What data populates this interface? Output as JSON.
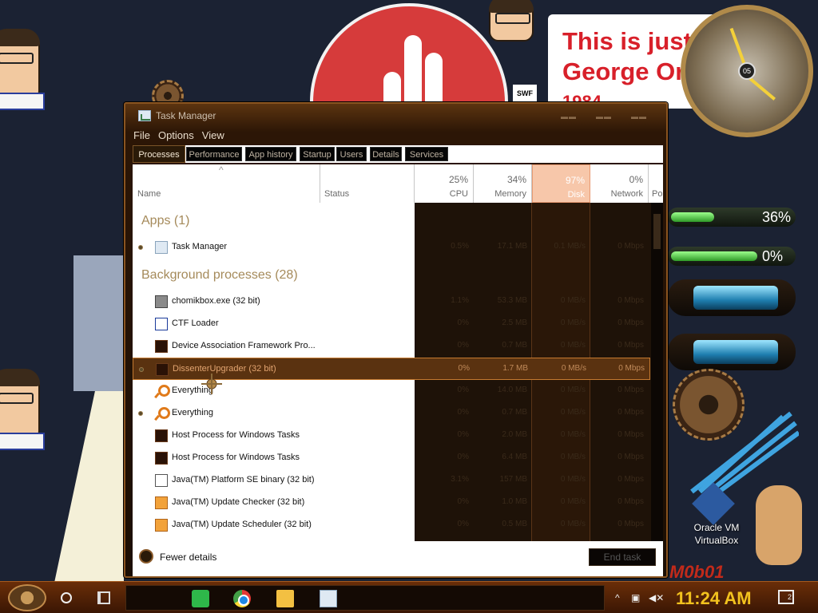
{
  "desktop": {
    "speech_lines": [
      "This is just",
      "George Orwell",
      "1984"
    ],
    "clock_center": "05",
    "meter_cpu": {
      "label": "36%",
      "fraction": 0.36
    },
    "meter_mem": {
      "label": "0%",
      "fraction": 0.0
    },
    "icon_label_line1": "Oracle VM",
    "icon_label_line2": "VirtualBox",
    "swf_label": "SWF",
    "brand_text": "M0b01"
  },
  "window": {
    "title": "Task Manager",
    "menu": [
      "File",
      "Options",
      "View"
    ],
    "tabs": [
      "Processes",
      "Performance",
      "App history",
      "Startup",
      "Users",
      "Details",
      "Services"
    ],
    "active_tab": "Processes"
  },
  "columns": {
    "name": "Name",
    "status": "Status",
    "cpu": {
      "pct": "25%",
      "label": "CPU"
    },
    "memory": {
      "pct": "34%",
      "label": "Memory"
    },
    "disk": {
      "pct": "97%",
      "label": "Disk"
    },
    "network": {
      "pct": "0%",
      "label": "Network"
    },
    "power": "Po"
  },
  "groups": {
    "apps": "Apps (1)",
    "background": "Background processes (28)"
  },
  "apps_rows": [
    {
      "name": "Task Manager",
      "cpu": "0.5%",
      "memory": "17.1 MB",
      "disk": "0.1 MB/s",
      "network": "0 Mbps",
      "icon": "monitor",
      "expandable": true
    }
  ],
  "bg_rows": [
    {
      "name": "chomikbox.exe (32 bit)",
      "cpu": "1.1%",
      "memory": "53.3 MB",
      "disk": "0 MB/s",
      "network": "0 Mbps",
      "icon": "gray",
      "expandable": false
    },
    {
      "name": "CTF Loader",
      "cpu": "0%",
      "memory": "2.5 MB",
      "disk": "0 MB/s",
      "network": "0 Mbps",
      "icon": "doc",
      "expandable": false
    },
    {
      "name": "Device Association Framework Pro...",
      "cpu": "0%",
      "memory": "0.7 MB",
      "disk": "0 MB/s",
      "network": "0 Mbps",
      "icon": "dark",
      "expandable": false
    },
    {
      "name": "DissenterUpgrader (32 bit)",
      "cpu": "0%",
      "memory": "1.7 MB",
      "disk": "0 MB/s",
      "network": "0 Mbps",
      "icon": "dark",
      "expandable": true,
      "selected": true
    },
    {
      "name": "Everything",
      "cpu": "0%",
      "memory": "14.0 MB",
      "disk": "0 MB/s",
      "network": "0 Mbps",
      "icon": "search",
      "expandable": false
    },
    {
      "name": "Everything",
      "cpu": "0%",
      "memory": "0.7 MB",
      "disk": "0 MB/s",
      "network": "0 Mbps",
      "icon": "search",
      "expandable": true
    },
    {
      "name": "Host Process for Windows Tasks",
      "cpu": "0%",
      "memory": "2.0 MB",
      "disk": "0 MB/s",
      "network": "0 Mbps",
      "icon": "dark",
      "expandable": false
    },
    {
      "name": "Host Process for Windows Tasks",
      "cpu": "0%",
      "memory": "6.4 MB",
      "disk": "0 MB/s",
      "network": "0 Mbps",
      "icon": "dark",
      "expandable": false
    },
    {
      "name": "Java(TM) Platform SE binary (32 bit)",
      "cpu": "3.1%",
      "memory": "157 MB",
      "disk": "0 MB/s",
      "network": "0 Mbps",
      "icon": "javabin",
      "expandable": false
    },
    {
      "name": "Java(TM) Update Checker (32 bit)",
      "cpu": "0%",
      "memory": "1.0 MB",
      "disk": "0 MB/s",
      "network": "0 Mbps",
      "icon": "java",
      "expandable": false
    },
    {
      "name": "Java(TM) Update Scheduler (32 bit)",
      "cpu": "0%",
      "memory": "0.5 MB",
      "disk": "0 MB/s",
      "network": "0 Mbps",
      "icon": "java",
      "expandable": false
    }
  ],
  "footer": {
    "fewer_details": "Fewer details",
    "end_task": "End task"
  },
  "taskbar": {
    "time": "11:24 AM",
    "notification_count": "2"
  }
}
